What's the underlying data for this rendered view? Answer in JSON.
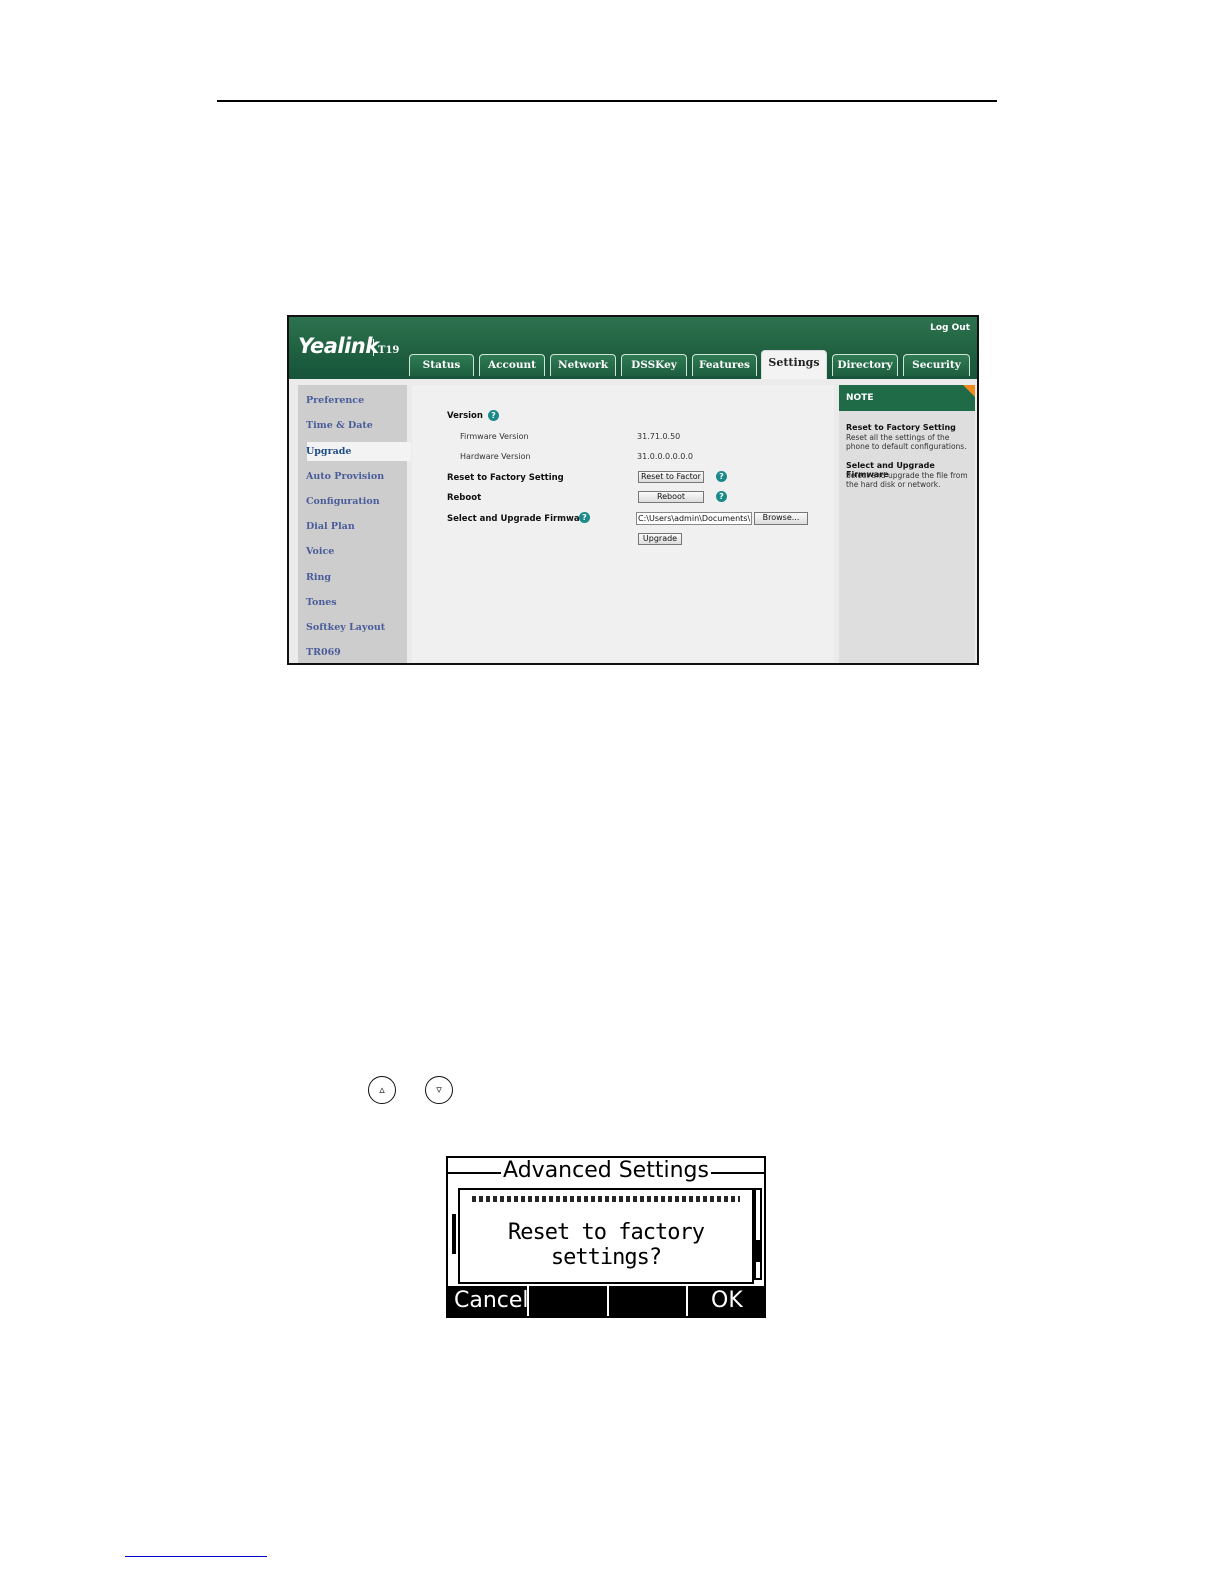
{
  "web_ui": {
    "logo": "Yealink",
    "model": "T19",
    "logout": "Log Out",
    "tabs": [
      "Status",
      "Account",
      "Network",
      "DSSKey",
      "Features",
      "Settings",
      "Directory",
      "Security"
    ],
    "active_tab": "Settings",
    "sidebar": [
      "Preference",
      "Time & Date",
      "Upgrade",
      "Auto Provision",
      "Configuration",
      "Dial Plan",
      "Voice",
      "Ring",
      "Tones",
      "Softkey Layout",
      "TR069"
    ],
    "active_sidebar": "Upgrade",
    "main": {
      "version_label": "Version",
      "firmware_label": "Firmware Version",
      "firmware_value": "31.71.0.50",
      "hardware_label": "Hardware Version",
      "hardware_value": "31.0.0.0.0.0.0",
      "reset_label": "Reset to Factory Setting",
      "reset_button": "Reset to Factor",
      "reboot_label": "Reboot",
      "reboot_button": "Reboot",
      "firmware_upgrade_label": "Select and Upgrade Firmware",
      "file_path": "C:\\Users\\admin\\Documents\\",
      "browse_button": "Browse...",
      "upgrade_button": "Upgrade"
    },
    "note": {
      "heading": "NOTE",
      "items": [
        {
          "title": "Reset to Factory Setting",
          "text": "Reset all the settings of the phone to default configurations."
        },
        {
          "title": "Select and Upgrade Firmware",
          "text": "Select and upgrade the file from the hard disk or network."
        }
      ]
    },
    "help_glyph": "?"
  },
  "nav_keys": {
    "up": "▵",
    "down": "▿"
  },
  "lcd": {
    "title": "Advanced Settings",
    "message": "Reset to factory settings?",
    "softkeys": [
      "Cancel",
      "",
      "",
      "OK"
    ]
  }
}
